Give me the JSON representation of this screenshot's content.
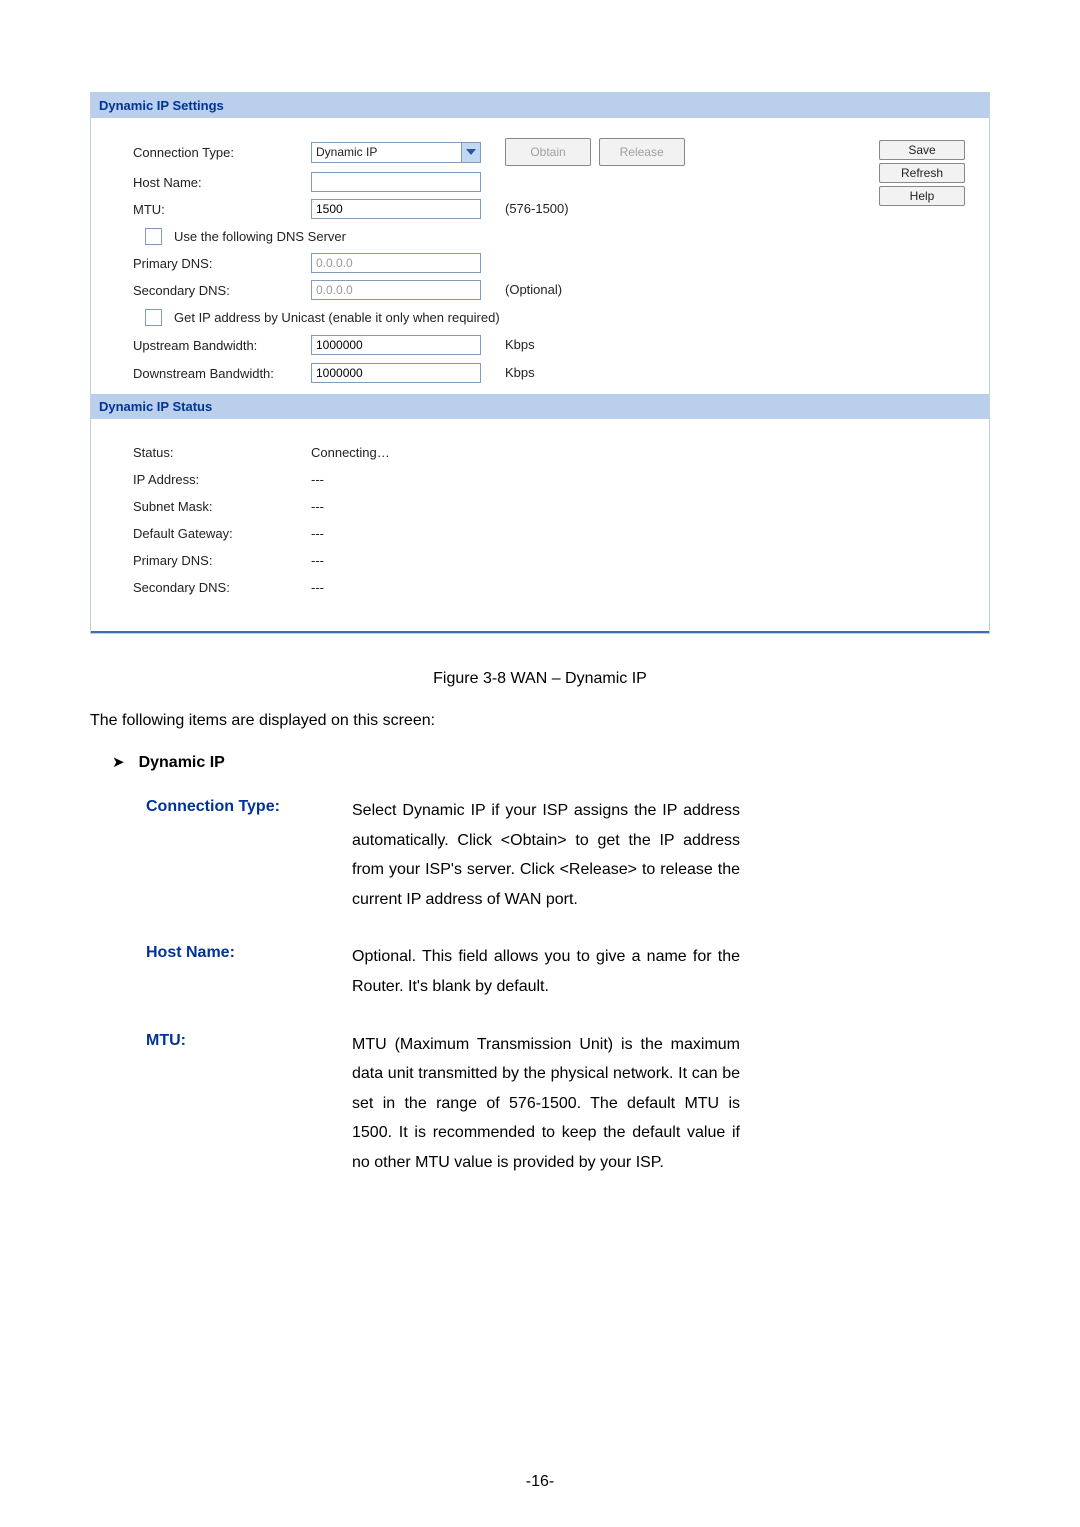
{
  "panel": {
    "settings_header": "Dynamic IP Settings",
    "connection_type_label": "Connection Type:",
    "connection_type_value": "Dynamic IP",
    "obtain_label": "Obtain",
    "release_label": "Release",
    "host_name_label": "Host Name:",
    "host_name_value": "",
    "mtu_label": "MTU:",
    "mtu_value": "1500",
    "mtu_range": "(576-1500)",
    "use_dns_label": "Use the following DNS Server",
    "primary_dns_label": "Primary DNS:",
    "primary_dns_placeholder": "0.0.0.0",
    "secondary_dns_label": "Secondary DNS:",
    "secondary_dns_placeholder": "0.0.0.0",
    "secondary_dns_optional": "(Optional)",
    "unicast_label": "Get IP address by Unicast (enable it only when required)",
    "up_bw_label": "Upstream Bandwidth:",
    "up_bw_value": "1000000",
    "up_bw_unit": "Kbps",
    "down_bw_label": "Downstream Bandwidth:",
    "down_bw_value": "1000000",
    "down_bw_unit": "Kbps",
    "save_label": "Save",
    "refresh_label": "Refresh",
    "help_label": "Help",
    "status_header": "Dynamic IP Status",
    "status_label": "Status:",
    "status_value": "Connecting…",
    "ip_label": "IP Address:",
    "ip_value": "---",
    "subnet_label": "Subnet Mask:",
    "subnet_value": "---",
    "gateway_label": "Default Gateway:",
    "gateway_value": "---",
    "pdns_label": "Primary DNS:",
    "pdns_value": "---",
    "sdns_label": "Secondary DNS:",
    "sdns_value": "---"
  },
  "doc": {
    "figure_caption": "Figure 3-8 WAN – Dynamic IP",
    "intro": "The following items are displayed on this screen:",
    "section_title": "Dynamic IP",
    "items": [
      {
        "label": "Connection Type:",
        "text": "Select Dynamic IP if your ISP assigns the IP address automatically. Click <Obtain> to get the IP address from your ISP's server. Click <Release> to release the current IP address of WAN port."
      },
      {
        "label": "Host Name:",
        "text": "Optional. This field allows you to give a name for the Router. It's blank by default."
      },
      {
        "label": "MTU:",
        "text": "MTU (Maximum Transmission Unit) is the maximum data unit transmitted by the physical network. It can be set in the range of 576-1500. The default MTU is 1500. It is recommended to keep the default value if no other MTU value is provided by your ISP."
      }
    ],
    "page_number": "-16-"
  }
}
